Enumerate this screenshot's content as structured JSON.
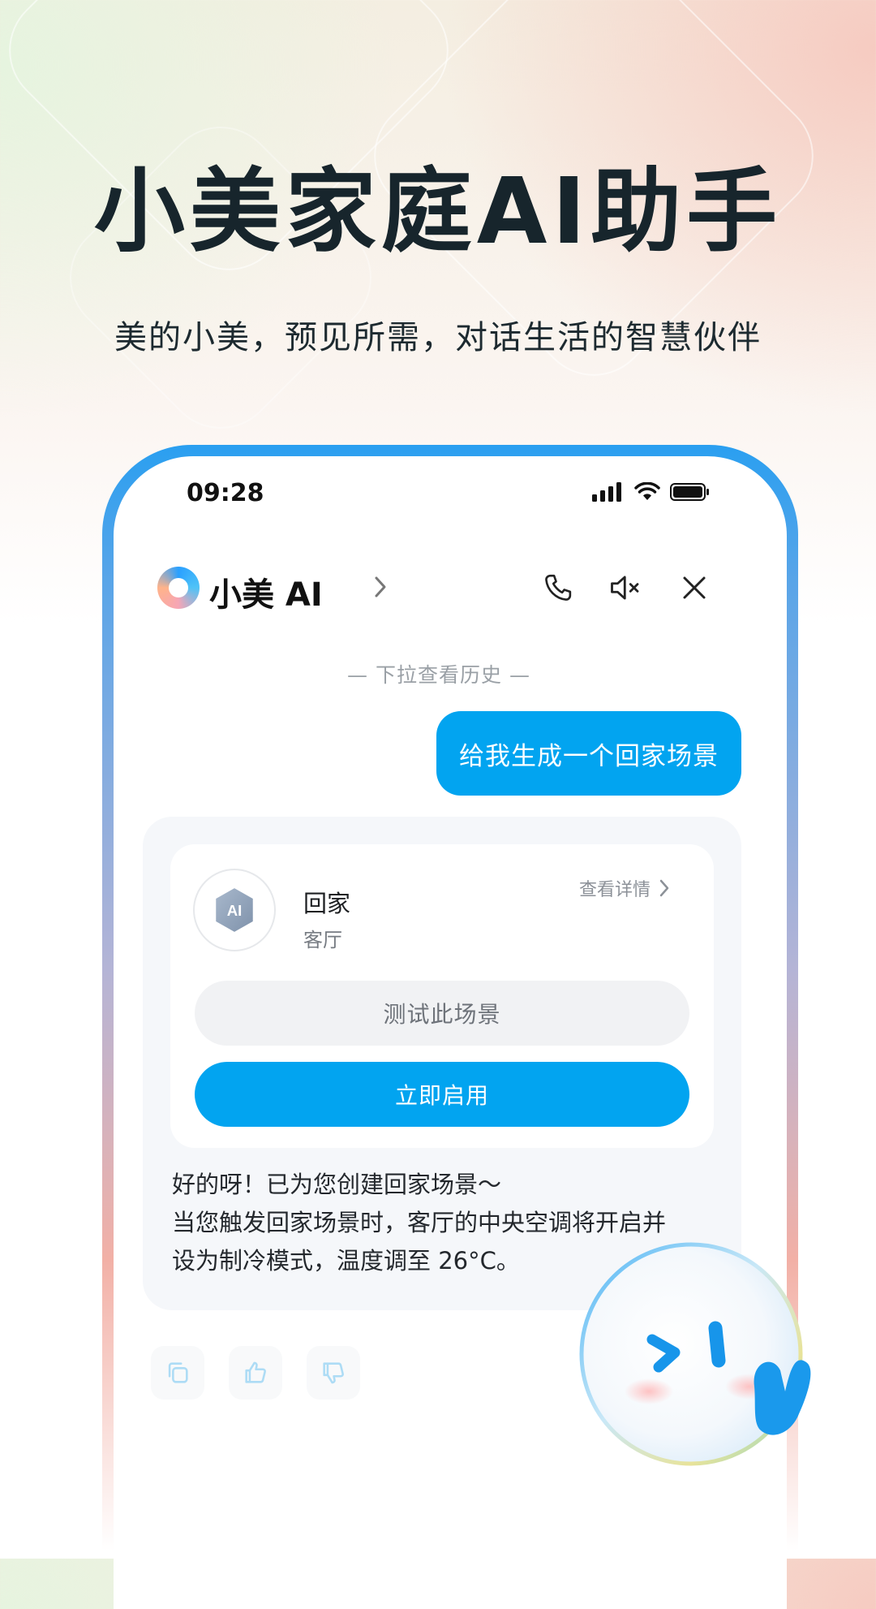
{
  "hero": {
    "title": "小美家庭AI助手",
    "subtitle": "美的小美，预见所需，对话生活的智慧伙伴"
  },
  "status_bar": {
    "time": "09:28",
    "icons": [
      "signal-icon",
      "wifi-icon",
      "battery-icon"
    ]
  },
  "header": {
    "app_name": "小美 AI",
    "icons": [
      "chevron-right-icon",
      "phone-icon",
      "mute-icon",
      "close-icon"
    ]
  },
  "chat": {
    "history_hint": "— 下拉查看历史 —",
    "user_message": "给我生成一个回家场景",
    "scene_card": {
      "avatar_text": "AI",
      "name": "回家",
      "room": "客厅",
      "detail_link": "查看详情",
      "test_button": "测试此场景",
      "enable_button": "立即启用"
    },
    "reply_lines": [
      "好的呀！已为您创建回家场景～",
      "当您触发回家场景时，客厅的中央空调将开启并",
      "设为制冷模式，温度调至 26°C。"
    ],
    "feedback_icons": [
      "copy-icon",
      "thumbs-up-icon",
      "thumbs-down-icon"
    ]
  },
  "colors": {
    "accent": "#02a4f0",
    "title": "#17252c"
  }
}
